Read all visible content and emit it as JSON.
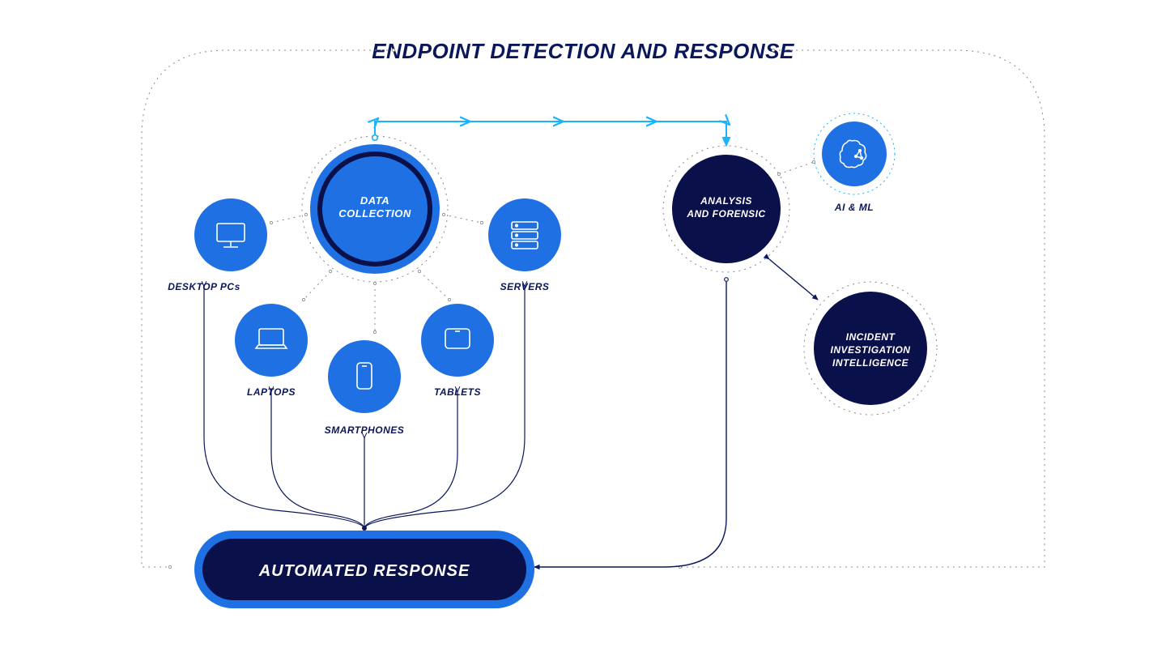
{
  "title": "ENDPOINT DETECTION AND RESPONSE",
  "colors": {
    "title": "#0a175a",
    "blue": "#1f71e3",
    "navy": "#0a1049",
    "cyan": "#19b4ff",
    "grey": "#888",
    "line": "#0a175a"
  },
  "nodes": {
    "data_collection": {
      "l1": "DATA",
      "l2": "COLLECTION"
    },
    "analysis": {
      "l1": "ANALYSIS",
      "l2": "AND FORENSIC"
    },
    "ai_ml": "AI & ML",
    "incident": {
      "l1": "INCIDENT",
      "l2": "INVESTIGATION",
      "l3": "INTELLIGENCE"
    },
    "desktop": "DESKTOP PCs",
    "laptops": "LAPTOPS",
    "smartphones": "SMARTPHONES",
    "tablets": "TABLETS",
    "servers": "SERVERS"
  },
  "automated_response": "AUTOMATED RESPONSE"
}
